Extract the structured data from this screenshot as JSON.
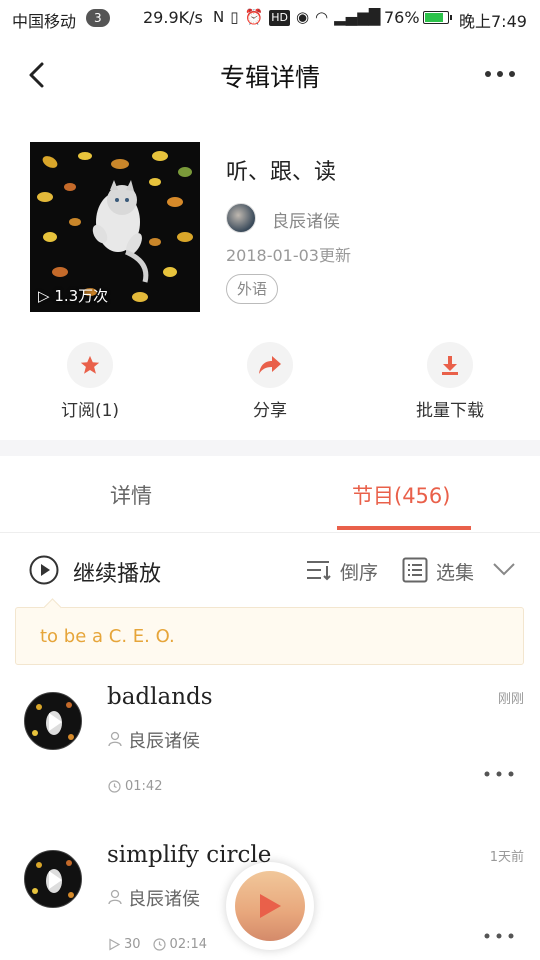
{
  "status_bar": {
    "carrier": "中国移动",
    "badge": "3",
    "net_speed": "29.9K/s",
    "battery_percent": "76%",
    "time": "晚上7:49",
    "icons": [
      "nfc-icon",
      "vibrate-icon",
      "alarm-icon",
      "hd-icon",
      "eye-icon",
      "wifi-icon",
      "signal-4g-icon"
    ]
  },
  "nav": {
    "title": "专辑详情",
    "back_icon": "back-arrow-icon",
    "more_icon": "more-dots-icon"
  },
  "album": {
    "title": "听、跟、读",
    "author": "良辰诸侯",
    "updated": "2018-01-03更新",
    "tag": "外语",
    "play_count": "1.3万次"
  },
  "actions": [
    {
      "label": "订阅(1)",
      "icon": "star-icon"
    },
    {
      "label": "分享",
      "icon": "share-arrow-icon"
    },
    {
      "label": "批量下载",
      "icon": "download-icon"
    }
  ],
  "tabs": {
    "details": "详情",
    "episodes": "节目(456)",
    "active": "episodes"
  },
  "controls": {
    "continue": "继续播放",
    "sort": "倒序",
    "select": "选集"
  },
  "tooltip": {
    "text": "to be a C. E. O."
  },
  "episodes": [
    {
      "title": "badlands",
      "author": "良辰诸侯",
      "duration": "01:42",
      "time_ago": "刚刚"
    },
    {
      "title": "simplify circle",
      "author": "良辰诸侯",
      "plays": "30",
      "duration": "02:14",
      "time_ago": "1天前"
    }
  ],
  "colors": {
    "accent": "#e9604a",
    "tooltip_text": "#e6a53a",
    "battery_fill": "#2cc24a"
  }
}
